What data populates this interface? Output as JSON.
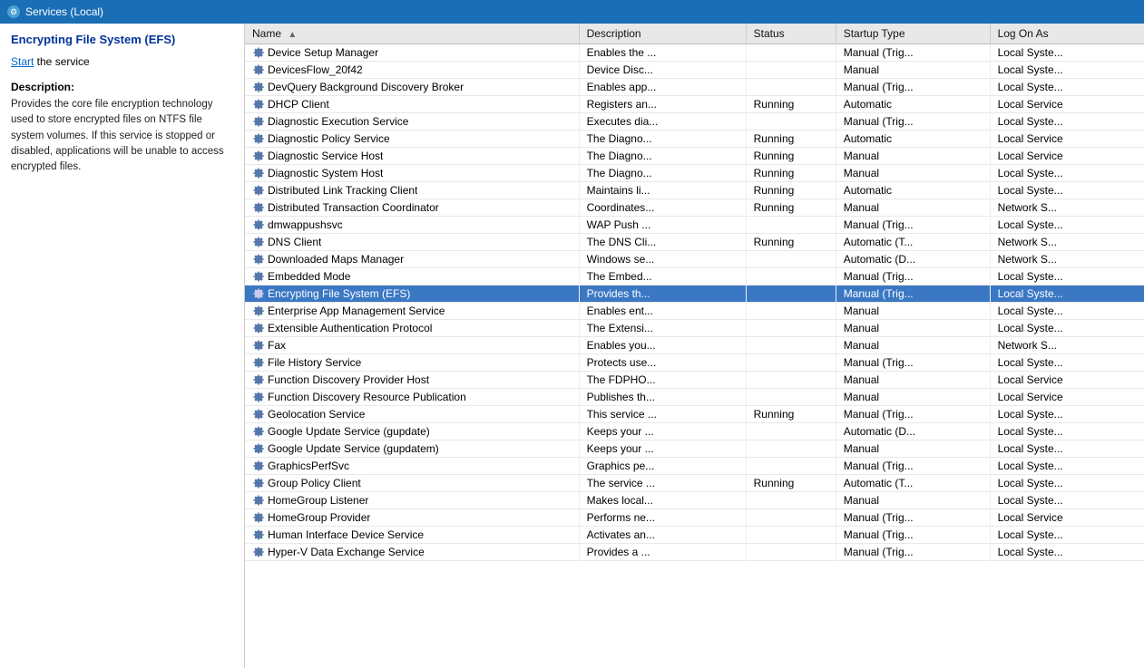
{
  "titlebar": {
    "icon": "⚙",
    "label": "Services (Local)"
  },
  "leftPanel": {
    "title": "Encrypting File System (EFS)",
    "linkText": "Start",
    "linkSuffix": " the service",
    "descriptionLabel": "Description:",
    "descriptionText": "Provides the core file encryption technology used to store encrypted files on NTFS file system volumes. If this service is stopped or disabled, applications will be unable to access encrypted files."
  },
  "tableHeaders": [
    {
      "id": "name",
      "label": "Name",
      "sortable": true
    },
    {
      "id": "description",
      "label": "Description",
      "sortable": false
    },
    {
      "id": "status",
      "label": "Status",
      "sortable": false
    },
    {
      "id": "startup",
      "label": "Startup Type",
      "sortable": false
    },
    {
      "id": "logon",
      "label": "Log On As",
      "sortable": false
    }
  ],
  "services": [
    {
      "name": "Device Setup Manager",
      "description": "Enables the ...",
      "status": "",
      "startup": "Manual (Trig...",
      "logon": "Local Syste..."
    },
    {
      "name": "DevicesFlow_20f42",
      "description": "Device Disc...",
      "status": "",
      "startup": "Manual",
      "logon": "Local Syste..."
    },
    {
      "name": "DevQuery Background Discovery Broker",
      "description": "Enables app...",
      "status": "",
      "startup": "Manual (Trig...",
      "logon": "Local Syste..."
    },
    {
      "name": "DHCP Client",
      "description": "Registers an...",
      "status": "Running",
      "startup": "Automatic",
      "logon": "Local Service"
    },
    {
      "name": "Diagnostic Execution Service",
      "description": "Executes dia...",
      "status": "",
      "startup": "Manual (Trig...",
      "logon": "Local Syste..."
    },
    {
      "name": "Diagnostic Policy Service",
      "description": "The Diagno...",
      "status": "Running",
      "startup": "Automatic",
      "logon": "Local Service"
    },
    {
      "name": "Diagnostic Service Host",
      "description": "The Diagno...",
      "status": "Running",
      "startup": "Manual",
      "logon": "Local Service"
    },
    {
      "name": "Diagnostic System Host",
      "description": "The Diagno...",
      "status": "Running",
      "startup": "Manual",
      "logon": "Local Syste..."
    },
    {
      "name": "Distributed Link Tracking Client",
      "description": "Maintains li...",
      "status": "Running",
      "startup": "Automatic",
      "logon": "Local Syste..."
    },
    {
      "name": "Distributed Transaction Coordinator",
      "description": "Coordinates...",
      "status": "Running",
      "startup": "Manual",
      "logon": "Network S..."
    },
    {
      "name": "dmwappushsvc",
      "description": "WAP Push ...",
      "status": "",
      "startup": "Manual (Trig...",
      "logon": "Local Syste..."
    },
    {
      "name": "DNS Client",
      "description": "The DNS Cli...",
      "status": "Running",
      "startup": "Automatic (T...",
      "logon": "Network S..."
    },
    {
      "name": "Downloaded Maps Manager",
      "description": "Windows se...",
      "status": "",
      "startup": "Automatic (D...",
      "logon": "Network S..."
    },
    {
      "name": "Embedded Mode",
      "description": "The Embed...",
      "status": "",
      "startup": "Manual (Trig...",
      "logon": "Local Syste..."
    },
    {
      "name": "Encrypting File System (EFS)",
      "description": "Provides th...",
      "status": "",
      "startup": "Manual (Trig...",
      "logon": "Local Syste...",
      "selected": true
    },
    {
      "name": "Enterprise App Management Service",
      "description": "Enables ent...",
      "status": "",
      "startup": "Manual",
      "logon": "Local Syste..."
    },
    {
      "name": "Extensible Authentication Protocol",
      "description": "The Extensi...",
      "status": "",
      "startup": "Manual",
      "logon": "Local Syste..."
    },
    {
      "name": "Fax",
      "description": "Enables you...",
      "status": "",
      "startup": "Manual",
      "logon": "Network S..."
    },
    {
      "name": "File History Service",
      "description": "Protects use...",
      "status": "",
      "startup": "Manual (Trig...",
      "logon": "Local Syste..."
    },
    {
      "name": "Function Discovery Provider Host",
      "description": "The FDPHO...",
      "status": "",
      "startup": "Manual",
      "logon": "Local Service"
    },
    {
      "name": "Function Discovery Resource Publication",
      "description": "Publishes th...",
      "status": "",
      "startup": "Manual",
      "logon": "Local Service"
    },
    {
      "name": "Geolocation Service",
      "description": "This service ...",
      "status": "Running",
      "startup": "Manual (Trig...",
      "logon": "Local Syste..."
    },
    {
      "name": "Google Update Service (gupdate)",
      "description": "Keeps your ...",
      "status": "",
      "startup": "Automatic (D...",
      "logon": "Local Syste..."
    },
    {
      "name": "Google Update Service (gupdatem)",
      "description": "Keeps your ...",
      "status": "",
      "startup": "Manual",
      "logon": "Local Syste..."
    },
    {
      "name": "GraphicsPerfSvc",
      "description": "Graphics pe...",
      "status": "",
      "startup": "Manual (Trig...",
      "logon": "Local Syste..."
    },
    {
      "name": "Group Policy Client",
      "description": "The service ...",
      "status": "Running",
      "startup": "Automatic (T...",
      "logon": "Local Syste..."
    },
    {
      "name": "HomeGroup Listener",
      "description": "Makes local...",
      "status": "",
      "startup": "Manual",
      "logon": "Local Syste..."
    },
    {
      "name": "HomeGroup Provider",
      "description": "Performs ne...",
      "status": "",
      "startup": "Manual (Trig...",
      "logon": "Local Service"
    },
    {
      "name": "Human Interface Device Service",
      "description": "Activates an...",
      "status": "",
      "startup": "Manual (Trig...",
      "logon": "Local Syste..."
    },
    {
      "name": "Hyper-V Data Exchange Service",
      "description": "Provides a ...",
      "status": "",
      "startup": "Manual (Trig...",
      "logon": "Local Syste..."
    }
  ]
}
